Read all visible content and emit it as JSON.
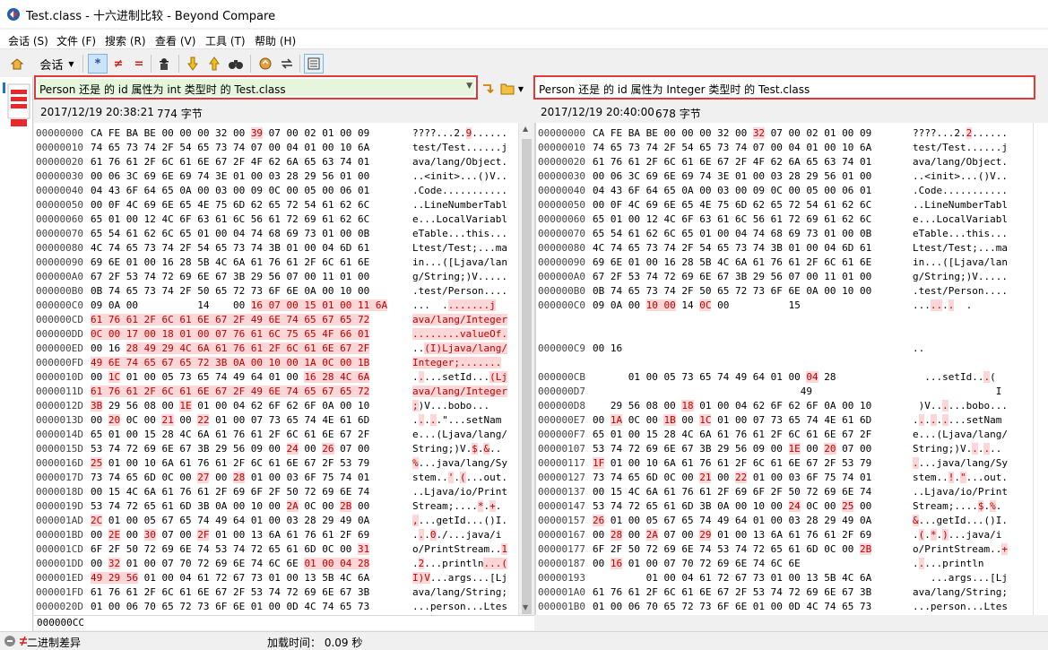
{
  "window": {
    "title": "Test.class - 十六进制比较 - Beyond Compare"
  },
  "menu": [
    "会话 (S)",
    "文件 (F)",
    "搜索 (R)",
    "查看 (V)",
    "工具 (T)",
    "帮助 (H)"
  ],
  "toolbar": {
    "session_label": "会话",
    "all_label": "*",
    "diff_label": "≠",
    "same_label": "="
  },
  "left": {
    "path": "Person 还是 的 id 属性为 int 类型时 的 Test.class",
    "date": "2017/12/19 20:38:21",
    "size": "774 字节",
    "rows": [
      {
        "a": "00000000",
        "h": "CA FE BA BE 00 00 00 32 00 [39] 07 00 02 01 00 09",
        "t": "????...2.[9]......"
      },
      {
        "a": "00000010",
        "h": "74 65 73 74 2F 54 65 73 74 07 00 04 01 00 10 6A",
        "t": "test/Test......j"
      },
      {
        "a": "00000020",
        "h": "61 76 61 2F 6C 61 6E 67 2F 4F 62 6A 65 63 74 01",
        "t": "ava/lang/Object."
      },
      {
        "a": "00000030",
        "h": "00 06 3C 69 6E 69 74 3E 01 00 03 28 29 56 01 00",
        "t": "..<init>...()V.."
      },
      {
        "a": "00000040",
        "h": "04 43 6F 64 65 0A 00 03 00 09 0C 00 05 00 06 01",
        "t": ".Code..........."
      },
      {
        "a": "00000050",
        "h": "00 0F 4C 69 6E 65 4E 75 6D 62 65 72 54 61 62 6C",
        "t": "..LineNumberTabl"
      },
      {
        "a": "00000060",
        "h": "65 01 00 12 4C 6F 63 61 6C 56 61 72 69 61 62 6C",
        "t": "e...LocalVariabl"
      },
      {
        "a": "00000070",
        "h": "65 54 61 62 6C 65 01 00 04 74 68 69 73 01 00 0B",
        "t": "eTable...this..."
      },
      {
        "a": "00000080",
        "h": "4C 74 65 73 74 2F 54 65 73 74 3B 01 00 04 6D 61",
        "t": "Ltest/Test;...ma"
      },
      {
        "a": "00000090",
        "h": "69 6E 01 00 16 28 5B 4C 6A 61 76 61 2F 6C 61 6E",
        "t": "in...([Ljava/lan"
      },
      {
        "a": "000000A0",
        "h": "67 2F 53 74 72 69 6E 67 3B 29 56 07 00 11 01 00",
        "t": "g/String;)V....."
      },
      {
        "a": "000000B0",
        "h": "0B 74 65 73 74 2F 50 65 72 73 6F 6E 0A 00 10 00",
        "t": ".test/Person...."
      },
      {
        "a": "000000C0",
        "h": "09 0A 00          14    00 [16 07 00 15 01 00 11 6A]",
        "t": "...  .[.......j]"
      },
      {
        "a": "000000CD",
        "h": "[61 76 61 2F 6C 61 6E 67 2F 49 6E 74 65 67 65 72]",
        "t": "[ava/lang/Integer]"
      },
      {
        "a": "000000DD",
        "h": "[0C 00 17 00 18 01 00 07 76 61 6C 75 65 4F 66 01]",
        "t": "[........valueOf.]"
      },
      {
        "a": "000000ED",
        "h": "00 16 [28 49 29 4C 6A 61 76 61 2F 6C 61 6E 67 2F]",
        "t": "..[(I)Ljava/lang/]"
      },
      {
        "a": "000000FD",
        "h": "[49 6E 74 65 67 65 72 3B 0A 00 10 00 1A 0C 00 1B]",
        "t": "[Integer;.......]"
      },
      {
        "a": "0000010D",
        "h": "00 [1C] 01 00 05 73 65 74 49 64 01 00 [16 28 4C 6A]",
        "t": ".[.]...setId...[(Lj]"
      },
      {
        "a": "0000011D",
        "h": "[61 76 61 2F 6C 61 6E 67 2F 49 6E 74 65 67 65 72]",
        "t": "[ava/lang/Integer]"
      },
      {
        "a": "0000012D",
        "h": "[3B] 29 56 08 00 [1E] 01 00 04 62 6F 62 6F 0A 00 10",
        "t": "[;])V...bobo..."
      },
      {
        "a": "0000013D",
        "h": "00 [20] 0C 00 [21] 00 [22] 01 00 07 73 65 74 4E 61 6D",
        "t": ".[.].[.].\"...setNam"
      },
      {
        "a": "0000014D",
        "h": "65 01 00 15 28 4C 6A 61 76 61 2F 6C 61 6E 67 2F",
        "t": "e...(Ljava/lang/"
      },
      {
        "a": "0000015D",
        "h": "53 74 72 69 6E 67 3B 29 56 09 00 [24] 00 [26] 07 00",
        "t": "String;)V.[$].[&].."
      },
      {
        "a": "0000016D",
        "h": "[25] 01 00 10 6A 61 76 61 2F 6C 61 6E 67 2F 53 79",
        "t": "[%]...java/lang/Sy"
      },
      {
        "a": "0000017D",
        "h": "73 74 65 6D 0C 00 [27] 00 [28] 01 00 03 6F 75 74 01",
        "t": "stem..['].[(]...out."
      },
      {
        "a": "0000018D",
        "h": "00 15 4C 6A 61 76 61 2F 69 6F 2F 50 72 69 6E 74",
        "t": "..Ljava/io/Print"
      },
      {
        "a": "0000019D",
        "h": "53 74 72 65 61 6D 3B 0A 00 10 00 [2A] 0C 00 [2B] 00",
        "t": "Stream;....[*].[+]."
      },
      {
        "a": "000001AD",
        "h": "[2C] 01 00 05 67 65 74 49 64 01 00 03 28 29 49 0A",
        "t": "[,]...getId...()I."
      },
      {
        "a": "000001BD",
        "h": "00 [2E] 00 [30] 07 00 [2F] 01 00 13 6A 61 76 61 2F 69",
        "t": ".[.].[0]./...java/i"
      },
      {
        "a": "000001CD",
        "h": "6F 2F 50 72 69 6E 74 53 74 72 65 61 6D 0C 00 [31]",
        "t": "o/PrintStream..[1]"
      },
      {
        "a": "000001DD",
        "h": "00 [32] 01 00 07 70 72 69 6E 74 6C 6E [01 00 04 28]",
        "t": ".[2]...println[...(]"
      },
      {
        "a": "000001ED",
        "h": "[49 29 56] 01 00 04 61 72 67 73 01 00 13 5B 4C 6A",
        "t": "[I)V]...args...[Lj"
      },
      {
        "a": "000001FD",
        "h": "61 76 61 2F 6C 61 6E 67 2F 53 74 72 69 6E 67 3B",
        "t": "ava/lang/String;"
      },
      {
        "a": "0000020D",
        "h": "01 00 06 70 65 72 73 6F 6E 01 00 0D 4C 74 65 73",
        "t": "...person...Ltes"
      }
    ]
  },
  "right": {
    "path": "Person 还是 的 id 属性为 Integer 类型时 的 Test.class",
    "date": "2017/12/19 20:40:00",
    "size": "678 字节",
    "rows": [
      {
        "a": "00000000",
        "h": "CA FE BA BE 00 00 00 32 00 [32] 07 00 02 01 00 09",
        "t": "????...2.[2]......"
      },
      {
        "a": "00000010",
        "h": "74 65 73 74 2F 54 65 73 74 07 00 04 01 00 10 6A",
        "t": "test/Test......j"
      },
      {
        "a": "00000020",
        "h": "61 76 61 2F 6C 61 6E 67 2F 4F 62 6A 65 63 74 01",
        "t": "ava/lang/Object."
      },
      {
        "a": "00000030",
        "h": "00 06 3C 69 6E 69 74 3E 01 00 03 28 29 56 01 00",
        "t": "..<init>...()V.."
      },
      {
        "a": "00000040",
        "h": "04 43 6F 64 65 0A 00 03 00 09 0C 00 05 00 06 01",
        "t": ".Code..........."
      },
      {
        "a": "00000050",
        "h": "00 0F 4C 69 6E 65 4E 75 6D 62 65 72 54 61 62 6C",
        "t": "..LineNumberTabl"
      },
      {
        "a": "00000060",
        "h": "65 01 00 12 4C 6F 63 61 6C 56 61 72 69 61 62 6C",
        "t": "e...LocalVariabl"
      },
      {
        "a": "00000070",
        "h": "65 54 61 62 6C 65 01 00 04 74 68 69 73 01 00 0B",
        "t": "eTable...this..."
      },
      {
        "a": "00000080",
        "h": "4C 74 65 73 74 2F 54 65 73 74 3B 01 00 04 6D 61",
        "t": "Ltest/Test;...ma"
      },
      {
        "a": "00000090",
        "h": "69 6E 01 00 16 28 5B 4C 6A 61 76 61 2F 6C 61 6E",
        "t": "in...([Ljava/lan"
      },
      {
        "a": "000000A0",
        "h": "67 2F 53 74 72 69 6E 67 3B 29 56 07 00 11 01 00",
        "t": "g/String;)V....."
      },
      {
        "a": "000000B0",
        "h": "0B 74 65 73 74 2F 50 65 72 73 6F 6E 0A 00 10 00",
        "t": ".test/Person...."
      },
      {
        "a": "000000C0",
        "h": "09 0A 00 [10 00] 14 [0C] 00          15",
        "t": "...[..].[.]  ."
      },
      {
        "a": "",
        "h": "",
        "t": ""
      },
      {
        "a": "",
        "h": "",
        "t": ""
      },
      {
        "a": "000000C9",
        "h": "00 16",
        "t": ".."
      },
      {
        "a": "",
        "h": "",
        "t": ""
      },
      {
        "a": "000000CB",
        "h": "      01 00 05 73 65 74 49 64 01 00 [04] 28",
        "t": "  ...setId..[.]("
      },
      {
        "a": "000000D7",
        "h": "                                   49",
        "t": "              I"
      },
      {
        "a": "000000D8",
        "h": "   29 56 08 00 [18] 01 00 04 62 6F 62 6F 0A 00 10",
        "t": " )V..[.]...bobo..."
      },
      {
        "a": "000000E7",
        "h": "00 [1A] 0C 00 [1B] 00 [1C] 01 00 07 73 65 74 4E 61 6D",
        "t": ".[.].[.].[.]...setNam"
      },
      {
        "a": "000000F7",
        "h": "65 01 00 15 28 4C 6A 61 76 61 2F 6C 61 6E 67 2F",
        "t": "e...(Ljava/lang/"
      },
      {
        "a": "00000107",
        "h": "53 74 72 69 6E 67 3B 29 56 09 00 [1E] 00 [20] 07 00",
        "t": "String;)V.[.].[.].."
      },
      {
        "a": "00000117",
        "h": "[1F] 01 00 10 6A 61 76 61 2F 6C 61 6E 67 2F 53 79",
        "t": "[.]...java/lang/Sy"
      },
      {
        "a": "00000127",
        "h": "73 74 65 6D 0C 00 [21] 00 [22] 01 00 03 6F 75 74 01",
        "t": "stem..[!].[\"]...out."
      },
      {
        "a": "00000137",
        "h": "00 15 4C 6A 61 76 61 2F 69 6F 2F 50 72 69 6E 74",
        "t": "..Ljava/io/Print"
      },
      {
        "a": "00000147",
        "h": "53 74 72 65 61 6D 3B 0A 00 10 00 [24] 0C 00 [25] 00",
        "t": "Stream;....[$].[%]."
      },
      {
        "a": "00000157",
        "h": "[26] 01 00 05 67 65 74 49 64 01 00 03 28 29 49 0A",
        "t": "[&]...getId...()I."
      },
      {
        "a": "00000167",
        "h": "00 [28] 00 [2A] 07 00 [29] 01 00 13 6A 61 76 61 2F 69",
        "t": ".[(].[*].[)]...java/i"
      },
      {
        "a": "00000177",
        "h": "6F 2F 50 72 69 6E 74 53 74 72 65 61 6D 0C 00 [2B]",
        "t": "o/PrintStream..[+]"
      },
      {
        "a": "00000187",
        "h": "00 [16] 01 00 07 70 72 69 6E 74 6C 6E",
        "t": ".[.]...println"
      },
      {
        "a": "00000193",
        "h": "         01 00 04 61 72 67 73 01 00 13 5B 4C 6A",
        "t": "   ...args...[Lj"
      },
      {
        "a": "000001A0",
        "h": "61 76 61 2F 6C 61 6E 67 2F 53 74 72 69 6E 67 3B",
        "t": "ava/lang/String;"
      },
      {
        "a": "000001B0",
        "h": "01 00 06 70 65 72 73 6F 6E 01 00 0D 4C 74 65 73",
        "t": "...person...Ltes"
      }
    ]
  },
  "statusstrip": {
    "address": "000000CC"
  },
  "statusbar": {
    "mode": "二进制差异",
    "load": "加载时间： 0.09 秒"
  },
  "colors": {
    "diff_bg": "#fdd7d7",
    "diff_fg": "#c00000",
    "highlight_border": "#e23a3a",
    "path_left_bg": "#e6f6dc"
  }
}
